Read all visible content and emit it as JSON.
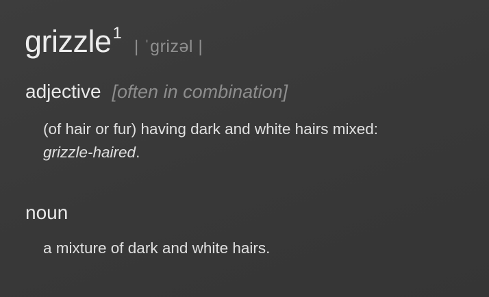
{
  "entry": {
    "headword": "grizzle",
    "homograph": "1",
    "pronunciation": "| ˈɡrizəl |"
  },
  "senses": [
    {
      "part_of_speech": "adjective",
      "grammar_note": "[often in combination]",
      "definition": "(of hair or fur) having dark and white hairs mixed:",
      "example": "grizzle-haired",
      "example_suffix": "."
    },
    {
      "part_of_speech": "noun",
      "definition": "a mixture of dark and white hairs."
    }
  ]
}
